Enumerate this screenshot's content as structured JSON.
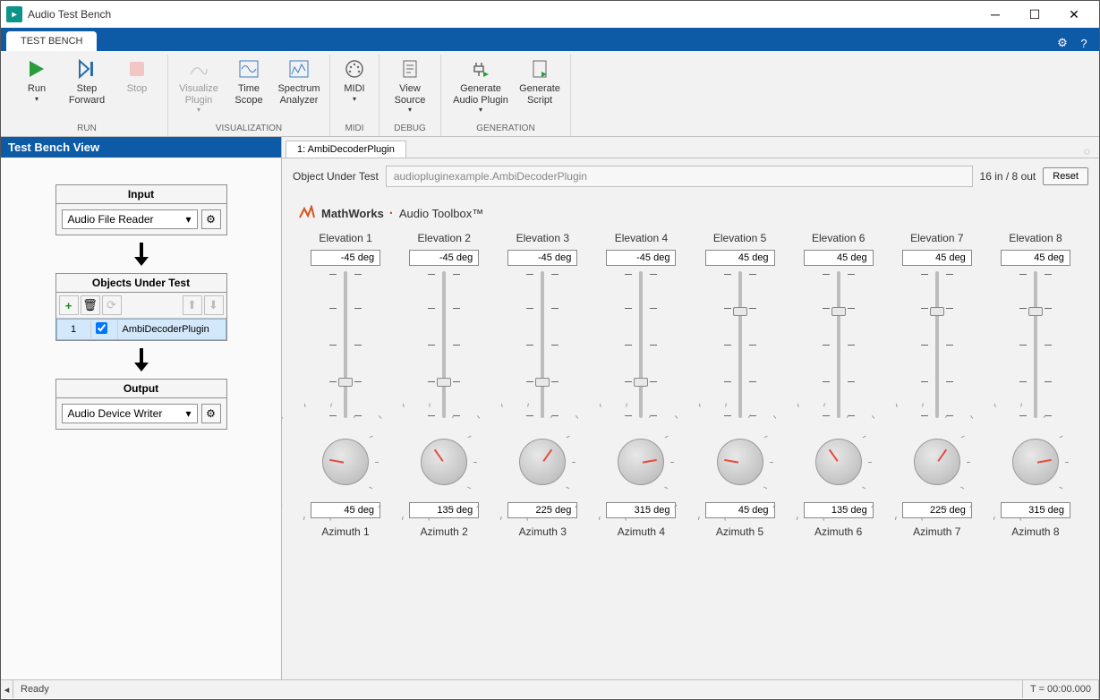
{
  "window": {
    "title": "Audio Test Bench"
  },
  "titlebar_buttons": {
    "min": "─",
    "max": "☐",
    "close": "✕"
  },
  "ribbon": {
    "tab": "TEST BENCH",
    "groups": {
      "run": {
        "label": "RUN",
        "items": [
          {
            "label": "Run",
            "dropdown": true
          },
          {
            "label": "Step Forward"
          },
          {
            "label": "Stop",
            "dim": true
          }
        ]
      },
      "viz": {
        "label": "VISUALIZATION",
        "items": [
          {
            "label": "Visualize Plugin",
            "dropdown": true,
            "dim": true
          },
          {
            "label": "Time Scope"
          },
          {
            "label": "Spectrum Analyzer"
          }
        ]
      },
      "midi": {
        "label": "MIDI",
        "items": [
          {
            "label": "MIDI",
            "dropdown": true
          }
        ]
      },
      "debug": {
        "label": "DEBUG",
        "items": [
          {
            "label": "View Source",
            "dropdown": true
          }
        ]
      },
      "gen": {
        "label": "GENERATION",
        "items": [
          {
            "label": "Generate Audio Plugin",
            "dropdown": true
          },
          {
            "label": "Generate Script"
          }
        ]
      }
    }
  },
  "left": {
    "header": "Test Bench View",
    "input": {
      "title": "Input",
      "value": "Audio File Reader"
    },
    "objects": {
      "title": "Objects Under Test",
      "row_idx": "1",
      "row_name": "AmbiDecoderPlugin"
    },
    "output": {
      "title": "Output",
      "value": "Audio Device Writer"
    }
  },
  "right": {
    "tab": "1: AmbiDecoderPlugin",
    "obj_label": "Object Under Test",
    "obj_value": "audiopluginexample.AmbiDecoderPlugin",
    "io_text": "16 in / 8 out",
    "reset": "Reset",
    "mathworks": "MathWorks",
    "toolbox": "Audio Toolbox™",
    "channels": [
      {
        "elev_label": "Elevation 1",
        "elev_val": "-45 deg",
        "slider_pos": 0.75,
        "knob_angle": -80,
        "az_val": "45 deg",
        "az_label": "Azimuth 1"
      },
      {
        "elev_label": "Elevation 2",
        "elev_val": "-45 deg",
        "slider_pos": 0.75,
        "knob_angle": -35,
        "az_val": "135 deg",
        "az_label": "Azimuth 2"
      },
      {
        "elev_label": "Elevation 3",
        "elev_val": "-45 deg",
        "slider_pos": 0.75,
        "knob_angle": 35,
        "az_val": "225 deg",
        "az_label": "Azimuth 3"
      },
      {
        "elev_label": "Elevation 4",
        "elev_val": "-45 deg",
        "slider_pos": 0.75,
        "knob_angle": 80,
        "az_val": "315 deg",
        "az_label": "Azimuth 4"
      },
      {
        "elev_label": "Elevation 5",
        "elev_val": "45 deg",
        "slider_pos": 0.25,
        "knob_angle": -80,
        "az_val": "45 deg",
        "az_label": "Azimuth 5"
      },
      {
        "elev_label": "Elevation 6",
        "elev_val": "45 deg",
        "slider_pos": 0.25,
        "knob_angle": -35,
        "az_val": "135 deg",
        "az_label": "Azimuth 6"
      },
      {
        "elev_label": "Elevation 7",
        "elev_val": "45 deg",
        "slider_pos": 0.25,
        "knob_angle": 35,
        "az_val": "225 deg",
        "az_label": "Azimuth 7"
      },
      {
        "elev_label": "Elevation 8",
        "elev_val": "45 deg",
        "slider_pos": 0.25,
        "knob_angle": 80,
        "az_val": "315 deg",
        "az_label": "Azimuth 8"
      }
    ]
  },
  "status": {
    "ready": "Ready",
    "time": "T = 00:00.000"
  }
}
